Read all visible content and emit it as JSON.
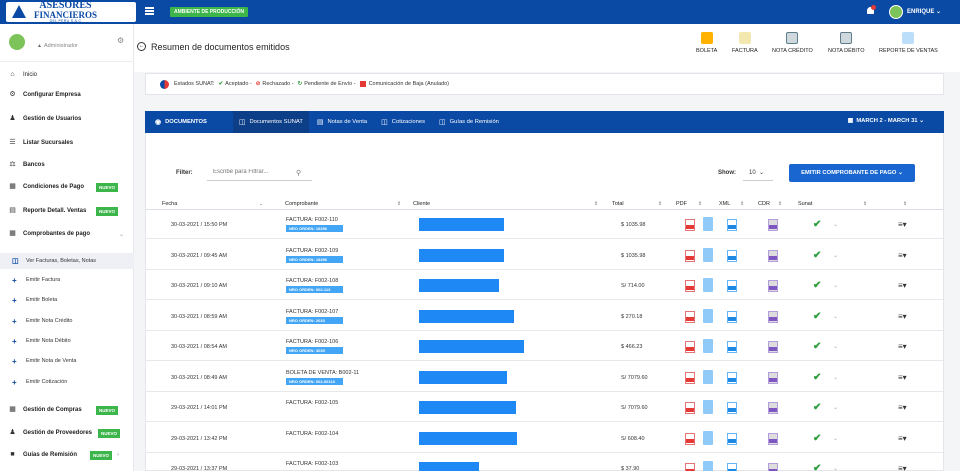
{
  "app": {
    "logo_line1": "ASESORES",
    "logo_line2": "FINANCIEROS",
    "logo_line3": "DEL PERU S.A.C",
    "env_badge": "AMBIENTE DE PRODUCCIÓN",
    "user_name": "ENRIQUE"
  },
  "colors": {
    "primary": "#0a4aa5",
    "success": "#3cb54a",
    "danger": "#e53935",
    "button": "#1a66d1"
  },
  "sidebar": {
    "role": "Administrador",
    "items": [
      {
        "label": "Inicio",
        "icon": "home-icon"
      },
      {
        "label": "Configurar Empresa",
        "icon": "gear-icon"
      },
      {
        "label": "Gestión de Usuarios",
        "icon": "users-icon"
      },
      {
        "label": "Listar Sucursales",
        "icon": "list-icon"
      },
      {
        "label": "Bancos",
        "icon": "bank-icon"
      },
      {
        "label": "Condiciones de Pago",
        "icon": "payment-icon",
        "badge": "NUEVO"
      },
      {
        "label": "Reporte Detall. Ventas",
        "icon": "report-icon",
        "badge": "NUEVO"
      },
      {
        "label": "Comprobantes de pago",
        "icon": "receipt-icon"
      }
    ],
    "submenu": [
      {
        "label": "Ver Facturas, Boletas, Notas"
      },
      {
        "label": "Emitir Factura"
      },
      {
        "label": "Emitir Boleta"
      },
      {
        "label": "Emitir Nota Crédito"
      },
      {
        "label": "Emitir Nota Débito"
      },
      {
        "label": "Emitir Nota de Venta"
      },
      {
        "label": "Emitir Cotización"
      }
    ],
    "bottom_items": [
      {
        "label": "Gestión de Compras",
        "badge": "NUEVO"
      },
      {
        "label": "Gestión de Proveedores",
        "badge": "NUEVO"
      },
      {
        "label": "Guías de Remisión",
        "badge": "NUEVO"
      }
    ]
  },
  "header": {
    "title": "Resumen de documentos emitidos",
    "actions": [
      "BOLETA",
      "FACTURA",
      "NOTA CRÉDITO",
      "NOTA DÉBITO",
      "REPORTE DE VENTAS"
    ]
  },
  "legend": {
    "prefix": "Estados SUNAT:",
    "accepted": "Aceptado -",
    "rejected": "Rechazado -",
    "pending": "Pendiente de Envío -",
    "baja": "Comunicación de Baja (Anulado)"
  },
  "tabs": {
    "main": "DOCUMENTOS",
    "items": [
      "Documentos SUNAT",
      "Notas de Venta",
      "Cotizaciones",
      "Guías de Remisión"
    ],
    "date_range": "MARCH 2 - MARCH 31"
  },
  "filters": {
    "label": "Filter:",
    "placeholder": "Escribe para Filtrar...",
    "show_label": "Show:",
    "show_value": "10",
    "emit_button": "EMITIR COMPROBANTE DE PAGO"
  },
  "table": {
    "columns": [
      "Fecha",
      "Comprobante",
      "Cliente",
      "Total",
      "PDF",
      "XML",
      "CDR",
      "Sunat"
    ],
    "rows": [
      {
        "date": "30-03-2021 / 15:50 PM",
        "doc": "FACTURA: F002-110",
        "order": "NRO ORDEN: 18396",
        "total": "$ 1035.98",
        "client_w": 85
      },
      {
        "date": "30-03-2021 / 09:45 AM",
        "doc": "FACTURA: F002-109",
        "order": "NRO ORDEN: 18396",
        "total": "$ 1035.98",
        "client_w": 85
      },
      {
        "date": "30-03-2021 / 09:10 AM",
        "doc": "FACTURA: F002-108",
        "order": "NRO ORDEN: 002-113",
        "total": "S/ 714.00",
        "client_w": 80
      },
      {
        "date": "30-03-2021 / 08:59 AM",
        "doc": "FACTURA: F002-107",
        "order": "NRO ORDEN: 2033",
        "total": "$ 270.18",
        "client_w": 95
      },
      {
        "date": "30-03-2021 / 08:54 AM",
        "doc": "FACTURA: F002-106",
        "order": "NRO ORDEN: 3035",
        "total": "$ 466.23",
        "client_w": 105
      },
      {
        "date": "30-03-2021 / 08:49 AM",
        "doc": "BOLETA DE VENTA: B002-11",
        "order": "NRO ORDEN: 002-00118",
        "total": "S/ 7079.60",
        "client_w": 88
      },
      {
        "date": "29-03-2021 / 14:01 PM",
        "doc": "FACTURA: F002-105",
        "order": "",
        "total": "S/ 7079.60",
        "client_w": 97
      },
      {
        "date": "29-03-2021 / 13:42 PM",
        "doc": "FACTURA: F002-104",
        "order": "",
        "total": "S/ 608.40",
        "client_w": 98
      },
      {
        "date": "29-03-2021 / 13:37 PM",
        "doc": "FACTURA: F002-103",
        "order": "",
        "total": "$ 37.90",
        "client_w": 60
      }
    ]
  }
}
